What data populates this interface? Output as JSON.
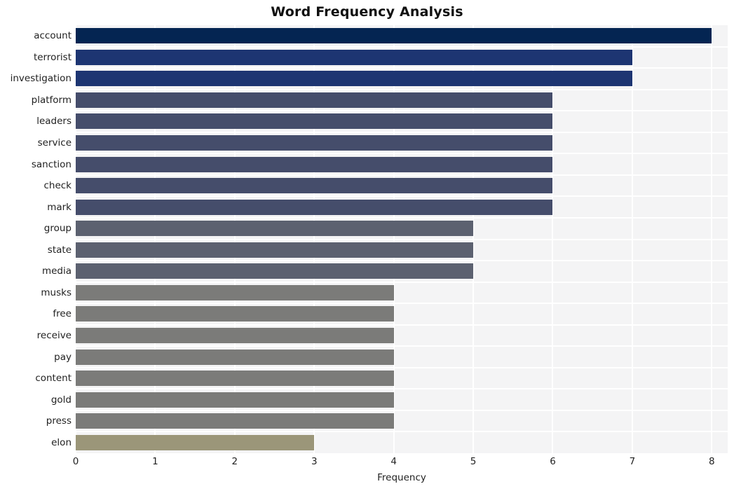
{
  "chart_data": {
    "type": "bar",
    "orientation": "horizontal",
    "title": "Word Frequency Analysis",
    "xlabel": "Frequency",
    "ylabel": "",
    "xlim": [
      0,
      8.2
    ],
    "xticks": [
      0,
      1,
      2,
      3,
      4,
      5,
      6,
      7,
      8
    ],
    "xtick_labels": [
      "0",
      "1",
      "2",
      "3",
      "4",
      "5",
      "6",
      "7",
      "8"
    ],
    "grid": true,
    "legend": null,
    "categories": [
      "account",
      "terrorist",
      "investigation",
      "platform",
      "leaders",
      "service",
      "sanction",
      "check",
      "mark",
      "group",
      "state",
      "media",
      "musks",
      "free",
      "receive",
      "pay",
      "content",
      "gold",
      "press",
      "elon"
    ],
    "values": [
      8,
      7,
      7,
      6,
      6,
      6,
      6,
      6,
      6,
      5,
      5,
      5,
      4,
      4,
      4,
      4,
      4,
      4,
      4,
      3
    ],
    "bar_colors": [
      "#042552",
      "#1d3572",
      "#1d3572",
      "#454d6b",
      "#454d6b",
      "#454d6b",
      "#454d6b",
      "#454d6b",
      "#454d6b",
      "#5c6170",
      "#5c6170",
      "#5c6170",
      "#7b7b79",
      "#7b7b79",
      "#7b7b79",
      "#7b7b79",
      "#7b7b79",
      "#7b7b79",
      "#7b7b79",
      "#9b9679"
    ]
  },
  "style": {
    "plot_background": "#f4f4f5",
    "figure_background": "#ffffff",
    "grid_color": "#ffffff",
    "text_color": "#222222",
    "title_color": "#101010"
  }
}
